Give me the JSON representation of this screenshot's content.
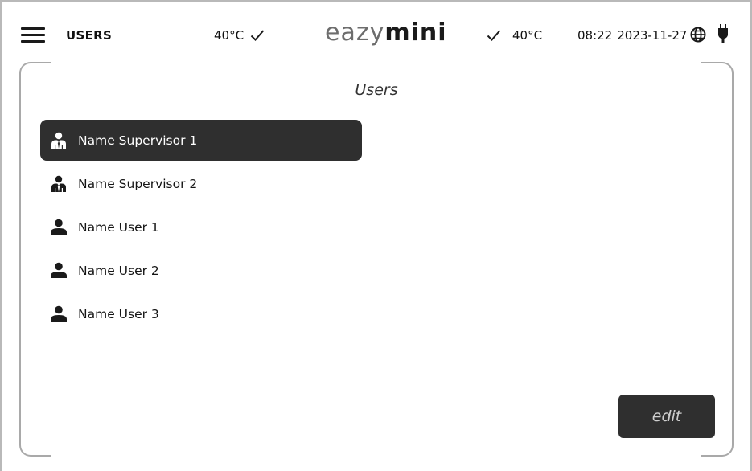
{
  "header": {
    "title": "USERS",
    "temperature_left": "40°C",
    "logo_part1": "eazy",
    "logo_part2": "mini",
    "temperature_right": "40°C",
    "time": "08:22",
    "date": "2023-11-27"
  },
  "panel": {
    "title": "Users",
    "users": [
      {
        "name": "Name Supervisor 1",
        "role": "supervisor",
        "icon": "supervisor-icon",
        "selected": true
      },
      {
        "name": "Name Supervisor 2",
        "role": "supervisor",
        "icon": "supervisor-icon",
        "selected": false
      },
      {
        "name": "Name User 1",
        "role": "user",
        "icon": "user-icon",
        "selected": false
      },
      {
        "name": "Name User 2",
        "role": "user",
        "icon": "user-icon",
        "selected": false
      },
      {
        "name": "Name User 3",
        "role": "user",
        "icon": "user-icon",
        "selected": false
      }
    ],
    "edit_label": "edit"
  },
  "colors": {
    "selected_bg": "#2f2f2f",
    "selected_text": "#ffffff",
    "frame": "#a9a9a9",
    "logo_light": "#6d6d6d",
    "logo_dark": "#1a1a1a"
  }
}
